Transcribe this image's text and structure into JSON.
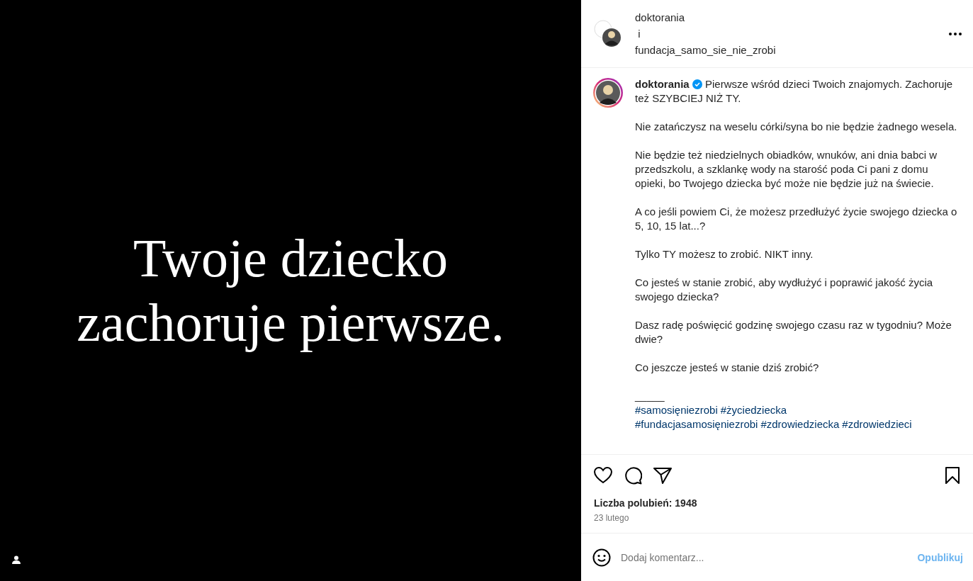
{
  "post_image": {
    "lines": [
      "Twoje dziecko",
      "zachoruje pierwsze."
    ]
  },
  "header": {
    "authors": [
      "doktorania",
      "fundacja_samo_sie_nie_zrobi"
    ],
    "joiner": "i"
  },
  "caption": {
    "username": "doktorania",
    "verified": true,
    "paragraphs": [
      "Pierwsze wśród dzieci Twoich znajomych. Zachoruje też SZYBCIEJ NIŻ TY.",
      "Nie zatańczysz na weselu córki/syna bo nie będzie żadnego wesela.",
      "Nie będzie też niedzielnych obiadków, wnuków, ani dnia babci w przedszkolu, a szklankę wody na starość poda Ci pani z domu opieki, bo Twojego dziecka być może nie będzie już na świecie.",
      "A co jeśli powiem Ci, że możesz przedłużyć życie swojego dziecka o 5, 10, 15 lat...?",
      "Tylko TY możesz to zrobić. NIKT inny.",
      "Co jesteś w stanie zrobić, aby wydłużyć i poprawić jakość życia swojego dziecka?",
      "Dasz radę poświęcić godzinę swojego czasu raz w tygodniu? Może dwie?",
      "Co jeszcze jesteś w stanie dziś zrobić?"
    ],
    "separator": "_____",
    "hashtag_lines": [
      [
        "#samosięniezrobi",
        "#życiedziecka"
      ],
      [
        "#fundacjasamosięniezrobi",
        "#zdrowiedziecka",
        "#zdrowiedzieci"
      ]
    ]
  },
  "actions": {
    "liked": false,
    "saved": false
  },
  "likes": "Liczba polubień: 1948",
  "date": "23 lutego",
  "comment": {
    "placeholder": "Dodaj komentarz...",
    "post_label": "Opublikuj",
    "post_disabled": true
  }
}
